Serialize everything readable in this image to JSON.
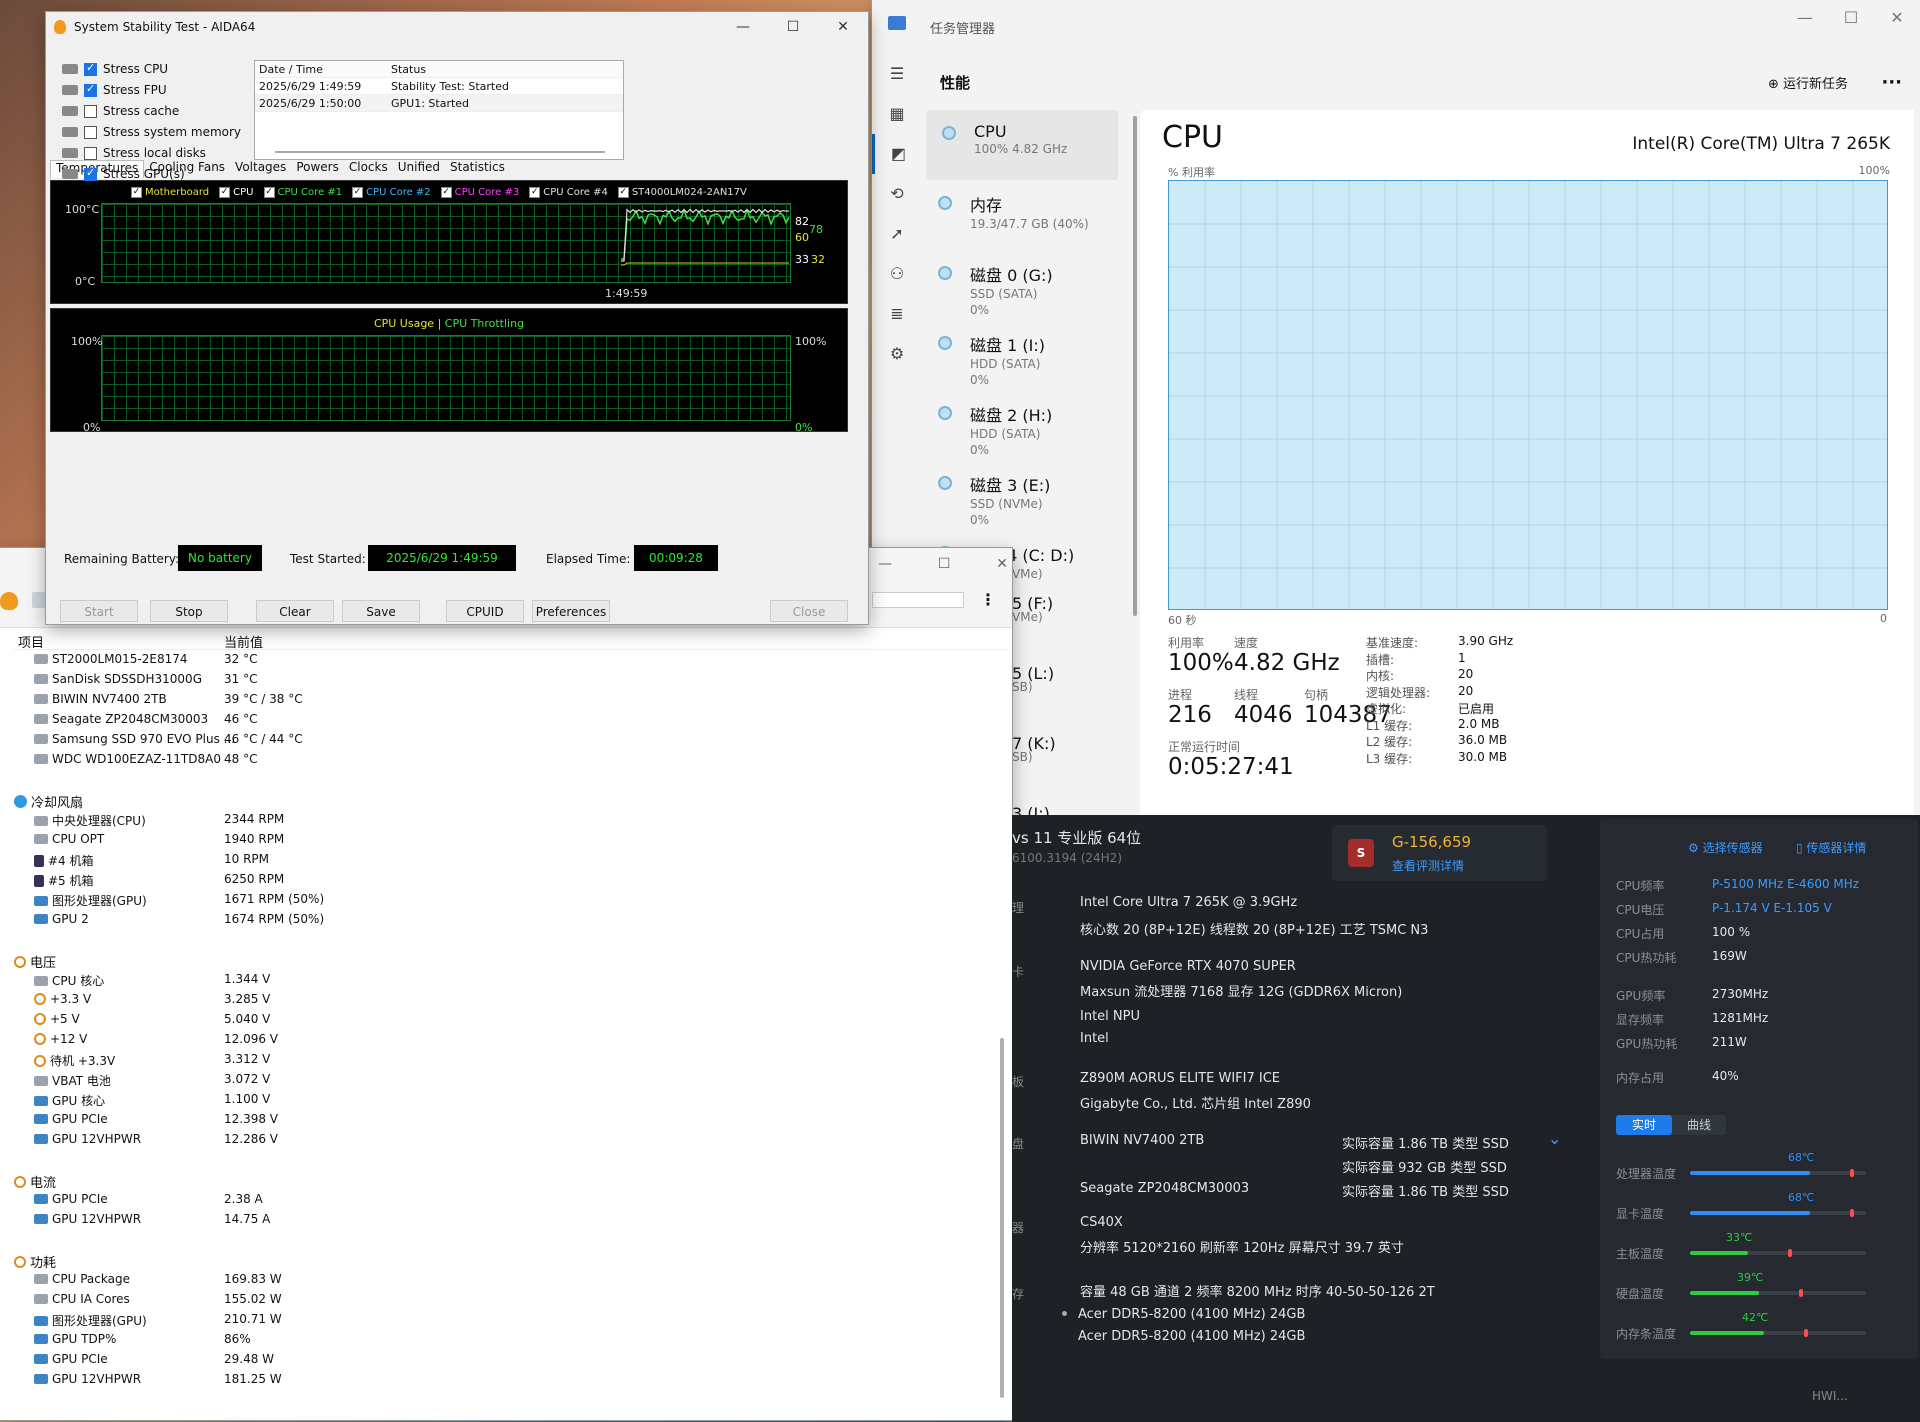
{
  "aida": {
    "title": "System Stability Test - AIDA64",
    "checks": [
      {
        "label": "Stress CPU",
        "on": true
      },
      {
        "label": "Stress FPU",
        "on": true
      },
      {
        "label": "Stress cache",
        "on": false
      },
      {
        "label": "Stress system memory",
        "on": false
      },
      {
        "label": "Stress local disks",
        "on": false
      },
      {
        "label": "Stress GPU(s)",
        "on": true
      }
    ],
    "log_headers": [
      "Date / Time",
      "Status"
    ],
    "log_rows": [
      [
        "2025/6/29 1:49:59",
        "Stability Test: Started"
      ],
      [
        "2025/6/29 1:50:00",
        "GPU1: Started"
      ]
    ],
    "tabs": [
      "Temperatures",
      "Cooling Fans",
      "Voltages",
      "Powers",
      "Clocks",
      "Unified",
      "Statistics"
    ],
    "temp_legend": [
      {
        "label": "Motherboard",
        "color": "#e6e629"
      },
      {
        "label": "CPU",
        "color": "#ffffff"
      },
      {
        "label": "CPU Core #1",
        "color": "#40e040"
      },
      {
        "label": "CPU Core #2",
        "color": "#3cb8ff"
      },
      {
        "label": "CPU Core #3",
        "color": "#ff40ff"
      },
      {
        "label": "CPU Core #4",
        "color": "#e0e0e0"
      },
      {
        "label": "ST4000LM024-2AN17V",
        "color": "#e0e0e0"
      }
    ],
    "temp_top": "100°C",
    "temp_bottom": "0°C",
    "temp_time": "1:49:59",
    "temp_right": [
      "82",
      "78",
      "60",
      "33",
      "32"
    ],
    "usage_title_a": "CPU Usage",
    "usage_sep": "|",
    "usage_title_b": "CPU Throttling",
    "usage_top_l": "100%",
    "usage_bot_l": "0%",
    "usage_top_r": "100%",
    "usage_bot_r": "0%",
    "battery_label": "Remaining Battery:",
    "battery_value": "No battery",
    "started_label": "Test Started:",
    "started_value": "2025/6/29 1:49:59",
    "elapsed_label": "Elapsed Time:",
    "elapsed_value": "00:09:28",
    "buttons": [
      "Start",
      "Stop",
      "Clear",
      "Save",
      "CPUID",
      "Preferences",
      "Close"
    ],
    "lcd_green": "#2ee82e"
  },
  "tm": {
    "title": "任务管理器",
    "section": "性能",
    "run_task": "运行新任务",
    "devices": [
      {
        "name": "CPU",
        "sub1": "100%  4.82 GHz",
        "sub2": ""
      },
      {
        "name": "内存",
        "sub1": "19.3/47.7 GB (40%)",
        "sub2": ""
      },
      {
        "name": "磁盘 0 (G:)",
        "sub1": "SSD (SATA)",
        "sub2": "0%"
      },
      {
        "name": "磁盘 1 (I:)",
        "sub1": "HDD (SATA)",
        "sub2": "0%"
      },
      {
        "name": "磁盘 2 (H:)",
        "sub1": "HDD (SATA)",
        "sub2": "0%"
      },
      {
        "name": "磁盘 3 (E:)",
        "sub1": "SSD (NVMe)",
        "sub2": "0%"
      },
      {
        "name": "磁盘 4 (C: D:)",
        "sub1": "SSD (NVMe)",
        "sub2": ""
      }
    ],
    "hidden_devices": [
      "5 (F:)",
      "VMe)",
      "5 (L:)",
      "SB)",
      "7 (K:)",
      "SB)",
      "3 (J:)"
    ],
    "cpu_title": "CPU",
    "cpu_model": "Intel(R) Core(TM) Ultra 7 265K",
    "util_label": "% 利用率",
    "util_max": "100%",
    "time_label": "60 秒",
    "time_zero": "0",
    "stats": {
      "util_k": "利用率",
      "util_v": "100%",
      "speed_k": "速度",
      "speed_v": "4.82 GHz",
      "proc_k": "进程",
      "proc_v": "216",
      "thread_k": "线程",
      "thread_v": "4046",
      "handle_k": "句柄",
      "handle_v": "104387",
      "uptime_k": "正常运行时间",
      "uptime_v": "0:05:27:41"
    },
    "specs": [
      [
        "基准速度:",
        "3.90 GHz"
      ],
      [
        "插槽:",
        "1"
      ],
      [
        "内核:",
        "20"
      ],
      [
        "逻辑处理器:",
        "20"
      ],
      [
        "虚拟化:",
        "已启用"
      ],
      [
        "L1 缓存:",
        "2.0 MB"
      ],
      [
        "L2 缓存:",
        "36.0 MB"
      ],
      [
        "L3 缓存:",
        "30.0 MB"
      ]
    ],
    "graph_color": "#3c9ad6"
  },
  "sensors": {
    "col_item": "项目",
    "col_value": "当前值",
    "disks": [
      [
        "ST2000LM015-2E8174",
        "32 °C"
      ],
      [
        "SanDisk SDSSDH31000G",
        "31 °C"
      ],
      [
        "BIWIN NV7400 2TB",
        "39 °C / 38 °C"
      ],
      [
        "Seagate ZP2048CM30003",
        "46 °C"
      ],
      [
        "Samsung SSD 970 EVO Plus ...",
        "46 °C / 44 °C"
      ],
      [
        "WDC WD100EZAZ-11TD8A0",
        "48 °C"
      ]
    ],
    "fans_title": "冷却风扇",
    "fans": [
      [
        "中央处理器(CPU)",
        "2344 RPM",
        "hw"
      ],
      [
        "CPU OPT",
        "1940 RPM",
        "hw"
      ],
      [
        "#4 机箱",
        "10 RPM",
        "case"
      ],
      [
        "#5 机箱",
        "6250 RPM",
        "case"
      ],
      [
        "图形处理器(GPU)",
        "1671 RPM  (50%)",
        "gpu"
      ],
      [
        "GPU 2",
        "1674 RPM  (50%)",
        "gpu"
      ]
    ],
    "volt_title": "电压",
    "volts": [
      [
        "CPU 核心",
        "1.344 V",
        "hw"
      ],
      [
        "+3.3 V",
        "3.285 V",
        "bolt"
      ],
      [
        "+5 V",
        "5.040 V",
        "bolt"
      ],
      [
        "+12 V",
        "12.096 V",
        "bolt"
      ],
      [
        "待机 +3.3V",
        "3.312 V",
        "bolt"
      ],
      [
        "VBAT 电池",
        "3.072 V",
        "bat"
      ],
      [
        "GPU 核心",
        "1.100 V",
        "gpu"
      ],
      [
        "GPU PCIe",
        "12.398 V",
        "gpu"
      ],
      [
        "GPU 12VHPWR",
        "12.286 V",
        "gpu"
      ]
    ],
    "curr_title": "电流",
    "currs": [
      [
        "GPU PCIe",
        "2.38 A",
        "gpu"
      ],
      [
        "GPU 12VHPWR",
        "14.75 A",
        "gpu"
      ]
    ],
    "power_title": "功耗",
    "powers": [
      [
        "CPU Package",
        "169.83 W",
        "hw"
      ],
      [
        "CPU IA Cores",
        "155.02 W",
        "hw"
      ],
      [
        "图形处理器(GPU)",
        "210.71 W",
        "gpu"
      ],
      [
        "GPU TDP%",
        "86%",
        "gpu"
      ],
      [
        "GPU PCIe",
        "29.48 W",
        "gpu"
      ],
      [
        "GPU 12VHPWR",
        "181.25 W",
        "gpu"
      ]
    ]
  },
  "summary": {
    "os": "vs 11 专业版 64位",
    "os_build": "6100.3194 (24H2)",
    "score_value": "G-156,659",
    "score_link": "查看评测详情",
    "score_badge": "S",
    "cut_labels": [
      "理",
      "卡",
      "板",
      "盘",
      "器",
      "存"
    ],
    "cpu_line1": "Intel Core Ultra 7 265K @ 3.9GHz",
    "cpu_line2": "核心数  20 (8P+12E)    线程数  20 (8P+12E)    工艺  TSMC N3",
    "gpu_line1": "NVIDIA GeForce RTX 4070 SUPER",
    "gpu_line2": "Maxsun    流处理器  7168    显存  12G (GDDR6X Micron)",
    "npu_line1": "Intel NPU",
    "npu_line2": "Intel",
    "mb_line1": "Z890M AORUS ELITE WIFI7 ICE",
    "mb_line2": "Gigabyte Co., Ltd.    芯片组  Intel Z890",
    "disk1": "BIWIN NV7400 2TB",
    "disk1_info": "实际容量  1.86 TB    类型  SSD",
    "disk2_info": "实际容量  932 GB    类型  SSD",
    "disk3": "Seagate ZP2048CM30003",
    "disk3_info": "实际容量  1.86 TB    类型  SSD",
    "mon_line1": "CS40X",
    "mon_line2": "分辨率  5120*2160    刷新率  120Hz    屏幕尺寸  39.7 英寸",
    "mem_line": "容量  48 GB    通道  2    频率  8200 MHz    时序  40-50-50-126 2T",
    "mem_stick1": "Acer DDR5-8200 (4100 MHz) 24GB",
    "mem_stick2": "Acer DDR5-8200 (4100 MHz) 24GB",
    "side_sensor_btn": "选择传感器",
    "side_detail_btn": "传感器详情",
    "side_rows": [
      [
        "CPU频率",
        "P-5100 MHz  E-4600 MHz",
        true
      ],
      [
        "CPU电压",
        "P-1.174 V  E-1.105 V",
        true
      ],
      [
        "CPU占用",
        "100 %",
        false
      ],
      [
        "CPU热功耗",
        "169W",
        false
      ],
      [
        "GPU频率",
        "2730MHz",
        false
      ],
      [
        "显存频率",
        "1281MHz",
        false
      ],
      [
        "GPU热功耗",
        "211W",
        false
      ],
      [
        "内存占用",
        "40%",
        false
      ]
    ],
    "tab_live": "实时",
    "tab_curve": "曲线",
    "temps": [
      {
        "label": "处理器温度",
        "value": "68℃",
        "fill": 0.68,
        "color": "#2f8df5"
      },
      {
        "label": "显卡温度",
        "value": "68℃",
        "fill": 0.68,
        "color": "#2f8df5"
      },
      {
        "label": "主板温度",
        "value": "33℃",
        "fill": 0.33,
        "color": "#2ecc40"
      },
      {
        "label": "硬盘温度",
        "value": "39℃",
        "fill": 0.39,
        "color": "#2ecc40"
      },
      {
        "label": "内存条温度",
        "value": "42℃",
        "fill": 0.42,
        "color": "#2ecc40"
      }
    ],
    "watermark": "HWI..."
  }
}
